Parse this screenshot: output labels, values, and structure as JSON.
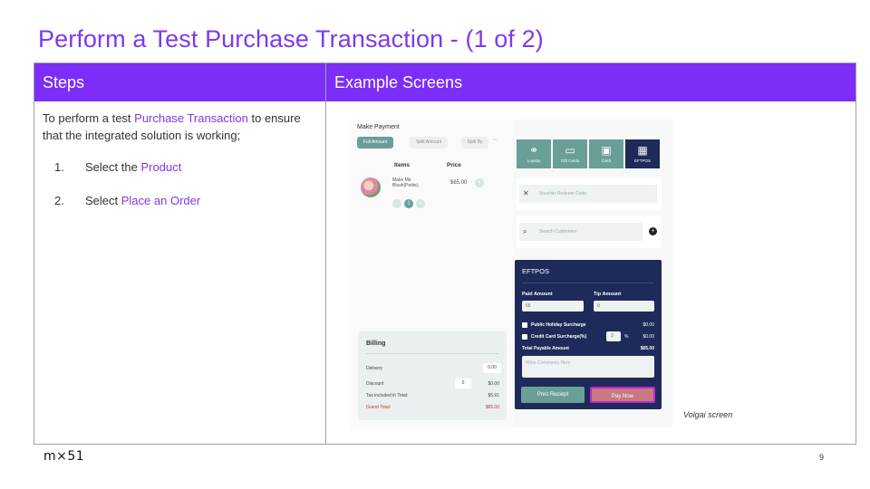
{
  "slide": {
    "title": "Perform a Test Purchase Transaction - (1 of 2)",
    "accent_color": "#7c3aed",
    "header_color": "#7c2df7",
    "page_number": "9",
    "logo_text": "m×51"
  },
  "table": {
    "col_steps": "Steps",
    "col_screens": "Example Screens"
  },
  "steps": {
    "intro_pre": "To perform a test ",
    "intro_link": "Purchase Transaction",
    "intro_post": " to ensure that the integrated solution is working;",
    "items": [
      {
        "num": "1.",
        "pre": "Select the ",
        "link": "Product"
      },
      {
        "num": "2.",
        "pre": "Select ",
        "link": "Place an Order"
      }
    ]
  },
  "screen": {
    "caption": "Volgai screen",
    "make_payment": "Make Payment",
    "pills": [
      "Full Amount",
      "Split Amount",
      "Split By",
      "···"
    ],
    "items_header": "Items",
    "price_header": "Price",
    "product_name": "Make Me Blush(Petite)",
    "product_price": "$65.00",
    "quantity": "1",
    "tiles": [
      {
        "label": "Loyalty",
        "icon": "loyalty-icon"
      },
      {
        "label": "Gift Cards",
        "icon": "gift-card-icon"
      },
      {
        "label": "Cash",
        "icon": "cash-icon"
      },
      {
        "label": "EFTPOS",
        "icon": "eftpos-terminal-icon"
      }
    ],
    "voucher_placeholder": "Voucher Redeem Code",
    "search_customers_placeholder": "Search Customers",
    "billing": {
      "title": "Billing",
      "delivery_label": "Delivery",
      "delivery_value": "0.00",
      "discount_label": "Discount",
      "discount_input": "0",
      "discount_value": "$0.00",
      "tax_label": "Tax included in Total:",
      "tax_value": "$5.91",
      "grand_label": "Grand Total:",
      "grand_value": "$65.00"
    },
    "eftpos": {
      "title": "EFTPOS",
      "paid_amount_label": "Paid Amount",
      "paid_amount_value": "65",
      "tip_amount_label": "Tip Amount",
      "tip_amount_value": "0",
      "holiday_label": "Public Holiday Surcharge",
      "holiday_value": "$0.00",
      "credit_label": "Credit Card Surcharge(%)",
      "credit_percent": "2",
      "credit_percent_sign": "%",
      "credit_value": "$0.00",
      "total_label": "Total Payable Amount",
      "total_value": "$65.00",
      "comments_placeholder": "Write Comments Here",
      "print_button": "Print Reciept",
      "pay_button": "Pay Now"
    }
  }
}
